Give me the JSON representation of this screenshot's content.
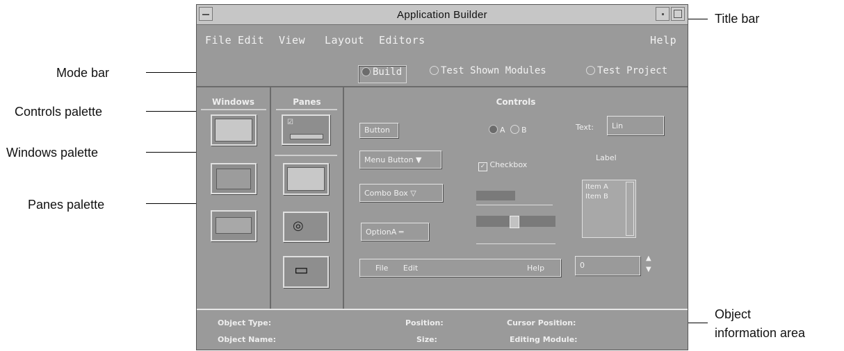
{
  "window": {
    "title": "Application Builder"
  },
  "menubar": {
    "file": "File",
    "edit": "Edit",
    "view": "View",
    "layout": "Layout",
    "editors": "Editors",
    "help": "Help"
  },
  "modebar": {
    "build": "Build",
    "test_shown": "Test Shown Modules",
    "test_project": "Test Project",
    "selected": "Build"
  },
  "palettes": {
    "windows": "Windows",
    "panes": "Panes",
    "controls": "Controls"
  },
  "controls": {
    "button": "Button",
    "radio_a": "A",
    "radio_b": "B",
    "text_label": "Text:",
    "text_value": "Lin",
    "menu_button": "Menu Button",
    "checkbox": "Checkbox",
    "label": "Label",
    "combo_box": "Combo Box",
    "list_items": [
      "Item A",
      "Item B"
    ],
    "option": "OptionA",
    "menubar_file": "File",
    "menubar_edit": "Edit",
    "menubar_help": "Help",
    "spin_value": "0"
  },
  "status": {
    "object_type": "Object Type:",
    "object_name": "Object Name:",
    "position": "Position:",
    "size": "Size:",
    "cursor_position": "Cursor Position:",
    "editing_module": "Editing Module:"
  },
  "callouts": {
    "title_bar": "Title bar",
    "mode_bar": "Mode bar",
    "controls_palette": "Controls palette",
    "windows_palette": "Windows palette",
    "panes_palette": "Panes palette",
    "object_info_line1": "Object",
    "object_info_line2": "information area"
  },
  "colors": {
    "window_bg": "#9a9a9a",
    "titlebar_bg": "#c6c6c6",
    "text_light": "#f0f0f0"
  }
}
